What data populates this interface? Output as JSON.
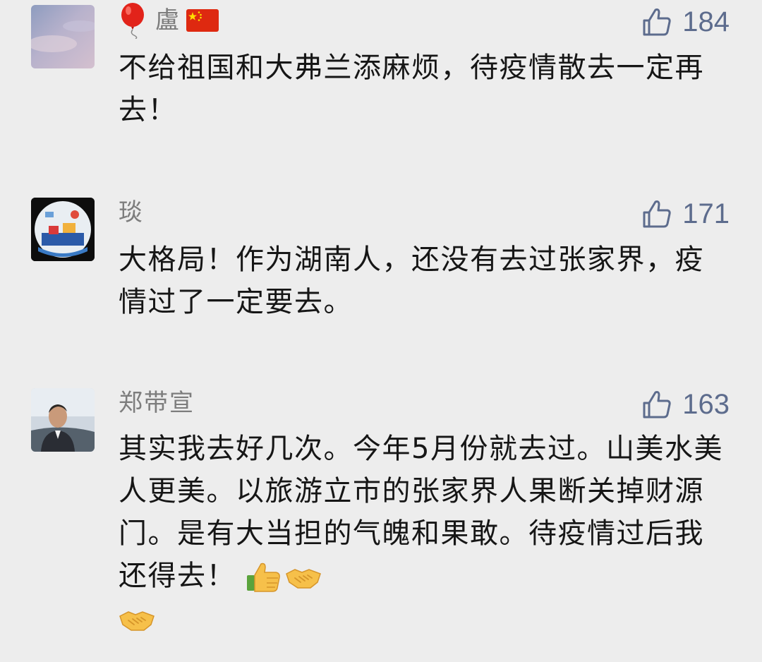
{
  "comments": [
    {
      "name": "盧",
      "likes": "184",
      "text": "不给祖国和大弗兰添麻烦，待疫情散去一定再去！"
    },
    {
      "name": "琰",
      "likes": "171",
      "text": "大格局！作为湖南人，还没有去过张家界，疫情过了一定要去。"
    },
    {
      "name": "郑带宣",
      "likes": "163",
      "text": "其实我去好几次。今年5月份就去过。山美水美人更美。以旅游立市的张家界人果断关掉财源门。是有大当担的气魄和果敢。待疫情过后我还得去！"
    }
  ],
  "icons": {
    "like": "thumbs-up-outline-icon",
    "balloon": "red-balloon-emoji",
    "flag": "china-flag-emoji",
    "thumbs_up_emoji": "thumbs-up-emoji",
    "handshake_emoji": "handshake-emoji"
  },
  "colors": {
    "background": "#ededed",
    "name": "#7d7d7d",
    "like": "#5d6c8d",
    "text": "#161616"
  }
}
